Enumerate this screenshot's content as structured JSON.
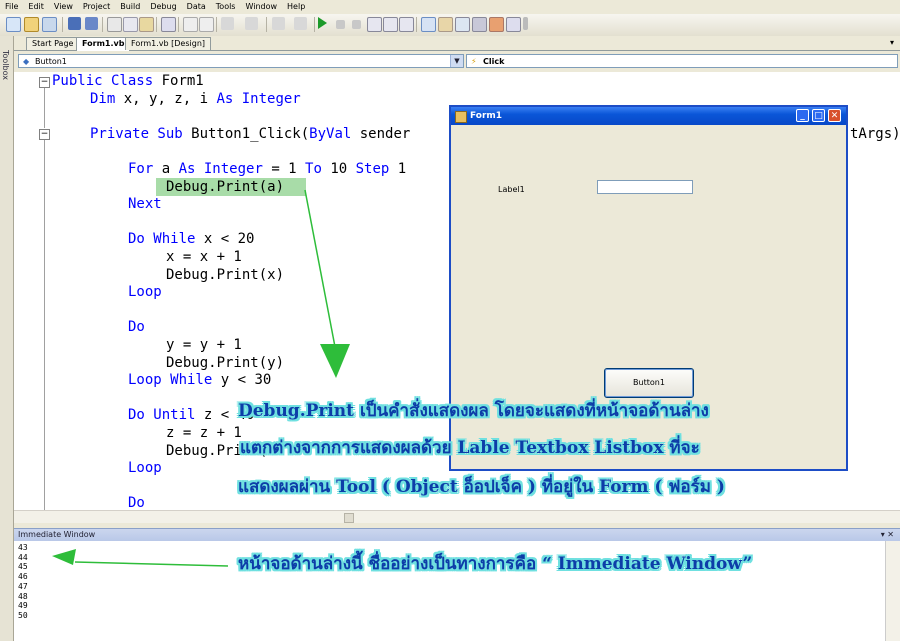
{
  "menu": [
    "File",
    "Edit",
    "View",
    "Project",
    "Build",
    "Debug",
    "Data",
    "Tools",
    "Window",
    "Help"
  ],
  "toolbox_label": "Toolbox",
  "tabs": [
    "Start Page",
    "Form1.vb",
    "Form1.vb [Design]"
  ],
  "combos": {
    "object": "Button1",
    "event": "Click"
  },
  "code_lines": [
    {
      "kw1": "Public Class",
      "rest": " Form1"
    },
    {
      "kw1": "Dim",
      "rest": " x, y, z, i ",
      "kw2": "As Integer"
    },
    {
      "kw1": "",
      "rest": ""
    },
    {
      "kw1": "Private Sub",
      "rest": " Button1_Click(",
      "kw2": "ByVal",
      "rest2": " sender"
    },
    {
      "kw1": "",
      "rest": ""
    },
    {
      "kw1": "For",
      "rest": " a ",
      "kw2": "As Integer",
      "rest2": " = 1 ",
      "kw3": "To",
      "rest3": " 10 ",
      "kw4": "Step",
      "rest4": " 1"
    },
    {
      "kw1": "",
      "rest": "Debug.Print(a)"
    },
    {
      "kw1": "Next",
      "rest": ""
    },
    {
      "kw1": "",
      "rest": ""
    },
    {
      "kw1": "Do While",
      "rest": " x < 20"
    },
    {
      "kw1": "",
      "rest": "x = x + 1"
    },
    {
      "kw1": "",
      "rest": "Debug.Print(x)"
    },
    {
      "kw1": "Loop",
      "rest": ""
    },
    {
      "kw1": "",
      "rest": ""
    },
    {
      "kw1": "Do",
      "rest": ""
    },
    {
      "kw1": "",
      "rest": "y = y + 1"
    },
    {
      "kw1": "",
      "rest": "Debug.Print(y)"
    },
    {
      "kw1": "Loop While",
      "rest": " y < 30"
    },
    {
      "kw1": "",
      "rest": ""
    },
    {
      "kw1": "Do Until",
      "rest": " z < 40"
    },
    {
      "kw1": "",
      "rest": "z = z + 1"
    },
    {
      "kw1": "",
      "rest": "Debug.Print("
    },
    {
      "kw1": "Loop",
      "rest": ""
    },
    {
      "kw1": "",
      "rest": ""
    },
    {
      "kw1": "Do",
      "rest": ""
    }
  ],
  "code_overflow": "tArgs)",
  "immediate": {
    "title": "Immediate Window",
    "lines": [
      "43",
      "44",
      "45",
      "46",
      "47",
      "48",
      "49",
      "50"
    ]
  },
  "form": {
    "title": "Form1",
    "label": "Label1",
    "button": "Button1"
  },
  "annotations": {
    "line1": "Debug.Print  เป็นคำสั่งแสดงผล โดยจะแสดงที่หน้าจอด้านล่าง",
    "line2": "แตกต่างจากการแสดงผลด้วย Lable  Textbox  Listbox  ที่จะ",
    "line3": "แสดงผลผ่าน Tool  ( Object  อ็อปเจ็ค )  ที่อยู่ใน Form ( ฟอร์ม )",
    "line4": "หน้าจอด้านล่างนี้  ชื่ออย่างเป็นทางการคือ “ Immediate Window”"
  },
  "colors": {
    "keyword": "#0000ff",
    "highlight": "#a8dca8",
    "annotation_text": "#0d3da8",
    "annotation_glow": "#6fe0e0",
    "arrow": "#2ebd3a"
  }
}
